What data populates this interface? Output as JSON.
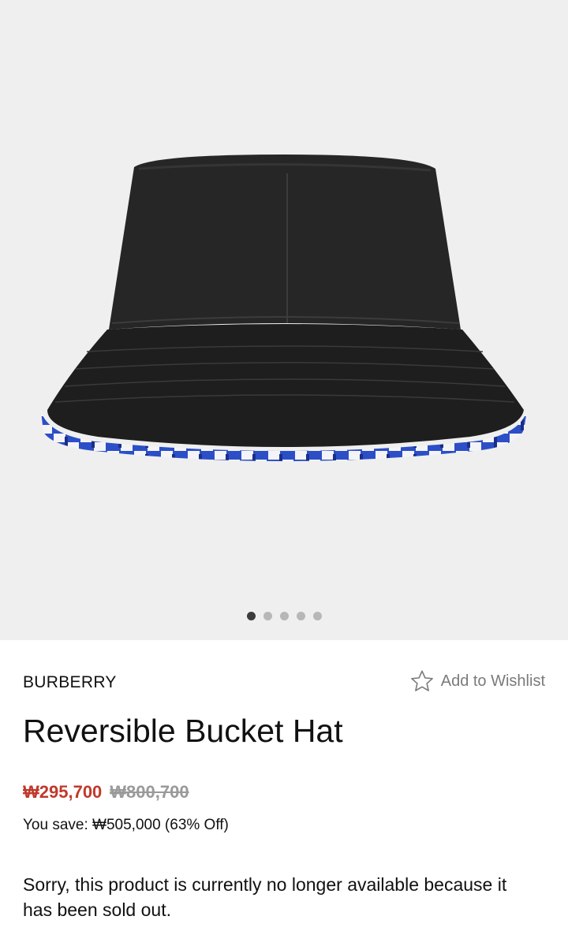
{
  "product": {
    "brand": "BURBERRY",
    "title": "Reversible Bucket Hat",
    "sale_price": "₩295,700",
    "original_price": "₩800,700",
    "savings_text": "You save: ₩505,000 (63% Off)",
    "availability_message": "Sorry, this product is currently no longer available because it has been sold out."
  },
  "wishlist": {
    "label": "Add to Wishlist",
    "icon": "star-outline-icon"
  },
  "gallery": {
    "image_count": 5,
    "active_index": 0
  },
  "colors": {
    "sale_price": "#c0392b",
    "original_price": "#9a9a9a",
    "gallery_background": "#efefef",
    "hat_outer": "#222222",
    "hat_lining_blue": "#2c4fc7"
  }
}
